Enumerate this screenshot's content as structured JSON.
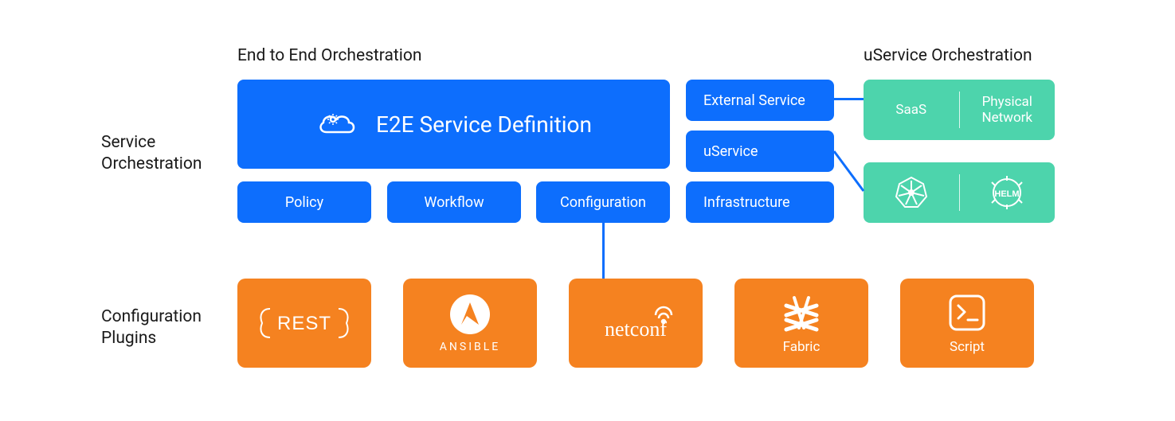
{
  "headers": {
    "e2e": "End to End Orchestration",
    "uservice": "uService Orchestration"
  },
  "sections": {
    "service_orch": "Service\nOrchestration",
    "config_plugins": "Configuration\nPlugins"
  },
  "main": {
    "e2e_def": "E2E Service Definition",
    "policy": "Policy",
    "workflow": "Workflow",
    "configuration": "Configuration",
    "external_service": "External Service",
    "uservice": "uService",
    "infrastructure": "Infrastructure"
  },
  "teal": {
    "saas": "SaaS",
    "physical_network": "Physical\nNetwork",
    "helm": "HELM"
  },
  "plugins": {
    "rest": "REST",
    "ansible": "ANSIBLE",
    "netconf": "netconf",
    "fabric": "Fabric",
    "script": "Script"
  },
  "colors": {
    "blue": "#0d6efd",
    "teal": "#4dd4ac",
    "orange": "#f58220"
  }
}
